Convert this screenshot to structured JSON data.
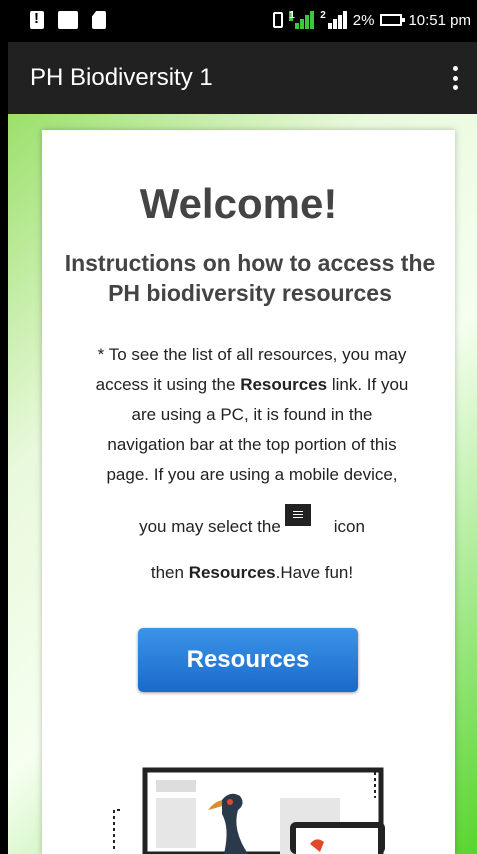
{
  "status_bar": {
    "battery_percent": "2%",
    "time": "10:51 pm",
    "signal_1": "1",
    "signal_2": "2"
  },
  "app_bar": {
    "title": "PH Biodiversity 1"
  },
  "content": {
    "heading": "Welcome!",
    "subheading": "Instructions on how to access the PH biodiversity resources",
    "p1": "* To see the list of all resources, you may access it using the ",
    "p1_bold": "Resources",
    "p1_rest": " link. If you are using a PC, it is found in the navigation bar at the top portion of this page. If you are using a mobile device,",
    "p2_a": "you may select the",
    "p2_b": "icon",
    "p3_a": "then ",
    "p3_bold": "Resources",
    "p3_rest": ".Have fun!",
    "button_label": "Resources"
  },
  "colors": {
    "button": "#1e72d2",
    "appbar": "#212121"
  }
}
